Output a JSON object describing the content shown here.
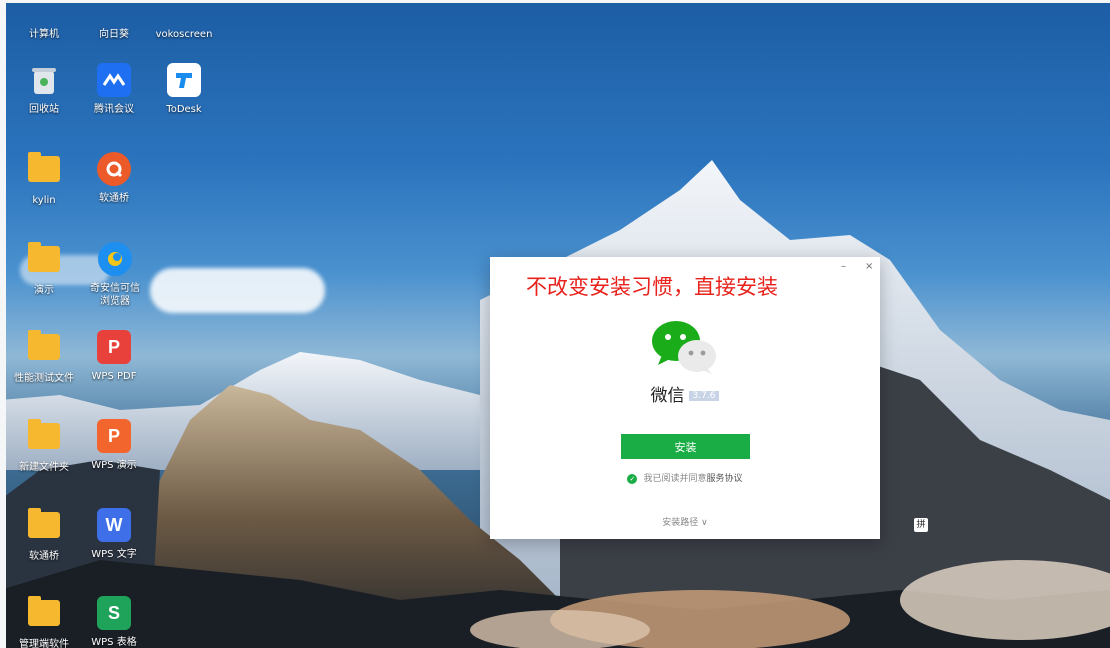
{
  "desktop": {
    "icons": [
      {
        "label": "计算机",
        "icon": "computer-icon"
      },
      {
        "label": "向日葵",
        "icon": "sunflower-icon"
      },
      {
        "label": "vokoscreen",
        "icon": "vokoscreen-icon"
      },
      {
        "label": "回收站",
        "icon": "recycle-bin-icon"
      },
      {
        "label": "腾讯会议",
        "icon": "tencent-meeting-icon"
      },
      {
        "label": "ToDesk",
        "icon": "todesk-icon"
      },
      {
        "label": "kylin",
        "icon": "folder-icon"
      },
      {
        "label": "软通桥",
        "icon": "ruantongqiao-icon"
      },
      {
        "label": "演示",
        "icon": "folder-icon"
      },
      {
        "label": "奇安信可信浏览器",
        "icon": "qianxin-browser-icon"
      },
      {
        "label": "性能测试文件",
        "icon": "folder-icon"
      },
      {
        "label": "WPS PDF",
        "icon": "wps-pdf-icon"
      },
      {
        "label": "新建文件夹",
        "icon": "folder-icon"
      },
      {
        "label": "WPS 演示",
        "icon": "wps-presentation-icon"
      },
      {
        "label": "软通桥",
        "icon": "folder-icon"
      },
      {
        "label": "WPS 文字",
        "icon": "wps-writer-icon"
      },
      {
        "label": "管理端软件",
        "icon": "folder-icon"
      },
      {
        "label": "WPS 表格",
        "icon": "wps-spreadsheet-icon"
      }
    ],
    "ime_indicator": "拼"
  },
  "installer": {
    "minimize": "–",
    "close": "×",
    "overlay_caption": "不改变安装习惯，直接安装",
    "app_name": "微信",
    "version": "3.7.6",
    "install_button": "安装",
    "agreement_prefix": "我已阅读并同意",
    "agreement_link": "服务协议",
    "install_path": "安装路径 ∨"
  },
  "colors": {
    "wechat_green": "#1aad45",
    "overlay_red": "#e8211b",
    "folder_yellow": "#f5b82e"
  }
}
